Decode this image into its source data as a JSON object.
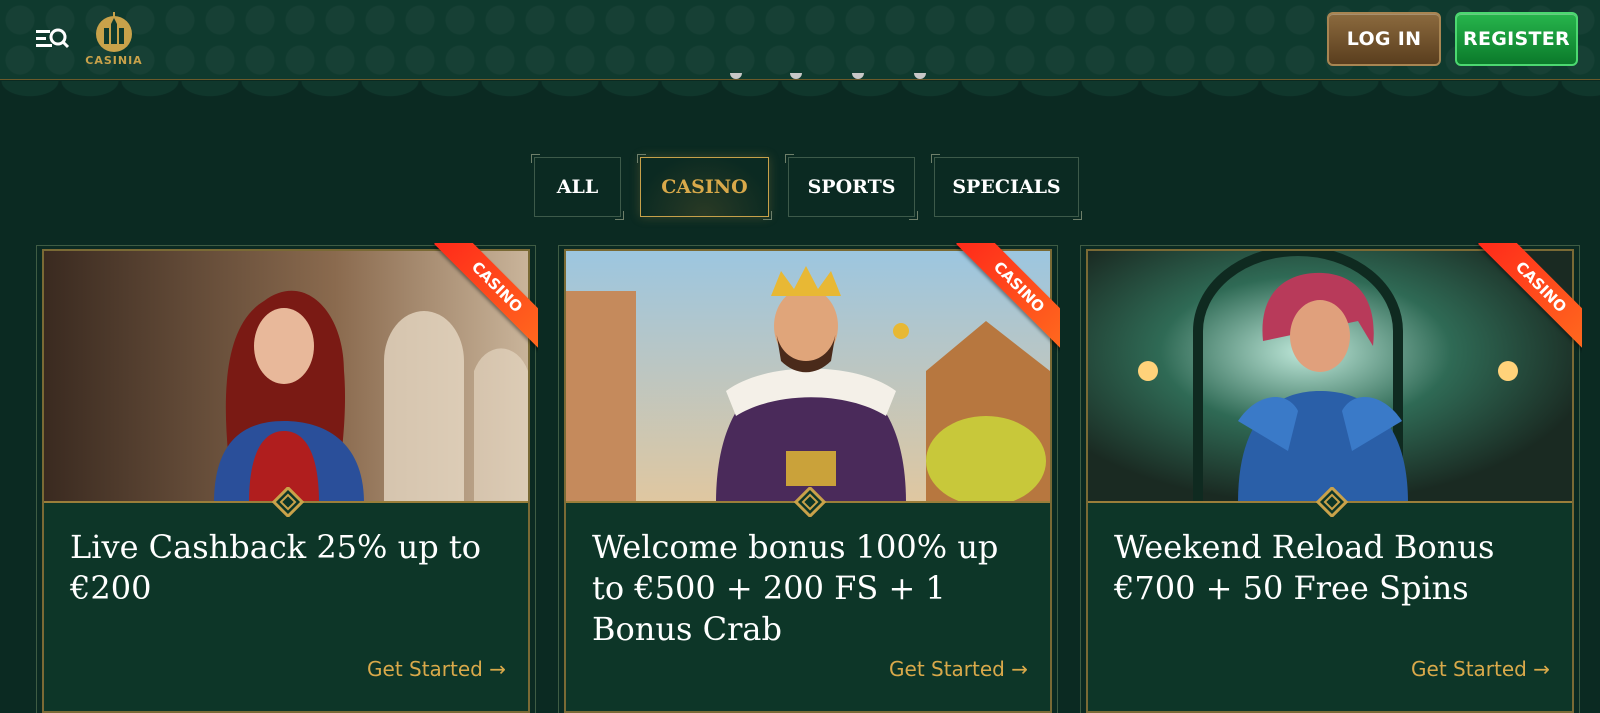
{
  "header": {
    "logo_text": "CASINIA",
    "login_label": "LOG IN",
    "register_label": "REGISTER",
    "menu_icon": "menu-search-icon"
  },
  "tabs": [
    {
      "label": "ALL",
      "active": false
    },
    {
      "label": "CASINO",
      "active": true
    },
    {
      "label": "SPORTS",
      "active": false
    },
    {
      "label": "SPECIALS",
      "active": false
    }
  ],
  "cards": [
    {
      "badge": "CASINO",
      "title": "Live Cashback 25% up to €200",
      "cta": "Get Started →"
    },
    {
      "badge": "CASINO",
      "title": "Welcome bonus 100% up to €500 + 200 FS + 1 Bonus Crab",
      "cta": "Get Started →"
    },
    {
      "badge": "CASINO",
      "title": "Weekend Reload Bonus €700 + 50 Free Spins",
      "cta": "Get Started →"
    }
  ],
  "colors": {
    "background": "#0b2a22",
    "accent_gold": "#d9a94a",
    "register_green": "#1fa845",
    "login_brown": "#7a5a33",
    "badge_red": "#ff3a1c"
  }
}
